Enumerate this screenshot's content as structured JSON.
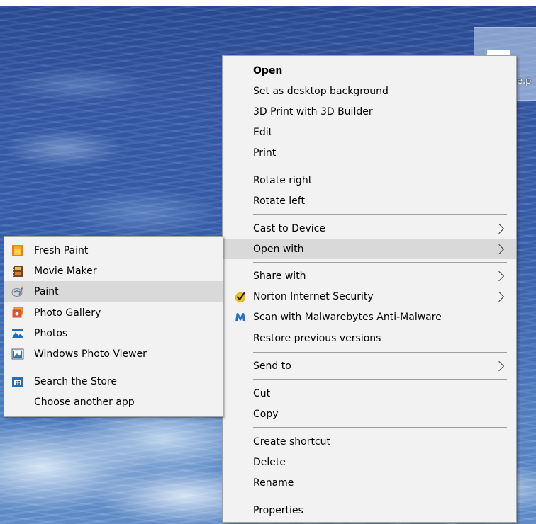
{
  "desktop": {
    "file_label": "e.p"
  },
  "context_menu": {
    "items": [
      {
        "label": "Open"
      },
      {
        "label": "Set as desktop background"
      },
      {
        "label": "3D Print with 3D Builder"
      },
      {
        "label": "Edit"
      },
      {
        "label": "Print"
      },
      {
        "label": "Rotate right"
      },
      {
        "label": "Rotate left"
      },
      {
        "label": "Cast to Device"
      },
      {
        "label": "Open with"
      },
      {
        "label": "Share with"
      },
      {
        "label": "Norton Internet Security"
      },
      {
        "label": "Scan with Malwarebytes Anti-Malware"
      },
      {
        "label": "Restore previous versions"
      },
      {
        "label": "Send to"
      },
      {
        "label": "Cut"
      },
      {
        "label": "Copy"
      },
      {
        "label": "Create shortcut"
      },
      {
        "label": "Delete"
      },
      {
        "label": "Rename"
      },
      {
        "label": "Properties"
      }
    ]
  },
  "open_with_menu": {
    "items": [
      {
        "label": "Fresh Paint",
        "icon": "fresh-paint-icon"
      },
      {
        "label": "Movie Maker",
        "icon": "movie-maker-icon"
      },
      {
        "label": "Paint",
        "icon": "paint-icon"
      },
      {
        "label": "Photo Gallery",
        "icon": "photo-gallery-icon"
      },
      {
        "label": "Photos",
        "icon": "photos-icon"
      },
      {
        "label": "Windows Photo Viewer",
        "icon": "windows-photo-viewer-icon"
      },
      {
        "label": "Search the Store",
        "icon": "store-icon"
      },
      {
        "label": "Choose another app"
      }
    ]
  },
  "colors": {
    "menu_bg": "#f2f2f2",
    "hover_bg": "#d9d9d9",
    "separator": "#a0a0a0"
  }
}
